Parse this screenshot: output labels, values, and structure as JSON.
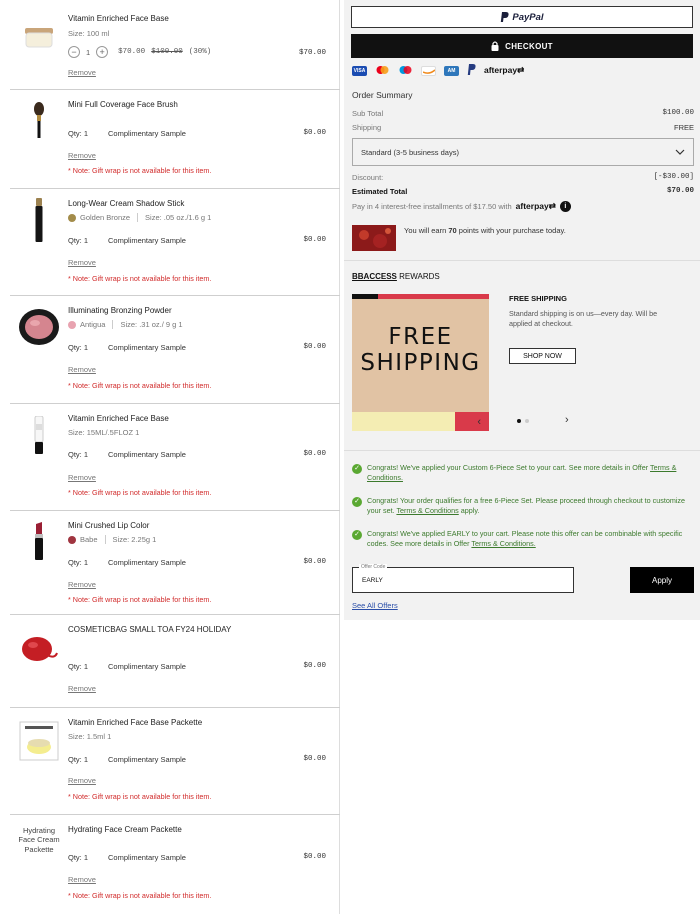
{
  "cart": {
    "items": [
      {
        "name": "Vitamin Enriched Face Base",
        "size": "Size: 100 ml",
        "qty_value": "1",
        "price_sale": "$70.00",
        "price_orig": "$100.00",
        "discount": "(30%)",
        "total": "$70.00",
        "remove": "Remove"
      },
      {
        "name": "Mini Full Coverage Face Brush",
        "qty": "Qty: 1",
        "comp": "Complimentary Sample",
        "total": "$0.00",
        "remove": "Remove",
        "note": "* Note: Gift wrap is not available for this item."
      },
      {
        "name": "Long-Wear Cream Shadow Stick",
        "shade": "Golden Bronze",
        "size": "Size: .05 oz./1.6 g 1",
        "swatch": "#a38c4a",
        "qty": "Qty: 1",
        "comp": "Complimentary Sample",
        "total": "$0.00",
        "remove": "Remove",
        "note": "* Note: Gift wrap is not available for this item."
      },
      {
        "name": "Illuminating Bronzing Powder",
        "shade": "Antigua",
        "size": "Size: .31 oz./ 9 g 1",
        "swatch": "#e8a3b0",
        "qty": "Qty: 1",
        "comp": "Complimentary Sample",
        "total": "$0.00",
        "remove": "Remove",
        "note": "* Note: Gift wrap is not available for this item."
      },
      {
        "name": "Vitamin Enriched Face Base",
        "size": "Size: 15ML/.5FLOZ 1",
        "qty": "Qty: 1",
        "comp": "Complimentary Sample",
        "total": "$0.00",
        "remove": "Remove",
        "note": "* Note: Gift wrap is not available for this item."
      },
      {
        "name": "Mini Crushed Lip Color",
        "shade": "Babe",
        "size": "Size: 2.25g 1",
        "swatch": "#a03540",
        "qty": "Qty: 1",
        "comp": "Complimentary Sample",
        "total": "$0.00",
        "remove": "Remove",
        "note": "* Note: Gift wrap is not available for this item."
      },
      {
        "name": "COSMETICBAG SMALL TOA FY24 HOLIDAY",
        "qty": "Qty: 1",
        "comp": "Complimentary Sample",
        "total": "$0.00",
        "remove": "Remove"
      },
      {
        "name": "Vitamin Enriched Face Base Packette",
        "size": "Size: 1.5ml 1",
        "qty": "Qty: 1",
        "comp": "Complimentary Sample",
        "total": "$0.00",
        "remove": "Remove",
        "note": "* Note: Gift wrap is not available for this item."
      },
      {
        "name": "Hydrating Face Cream Packette",
        "alt": "Hydrating Face Cream Packette",
        "qty": "Qty: 1",
        "comp": "Complimentary Sample",
        "total": "$0.00",
        "remove": "Remove",
        "note": "* Note: Gift wrap is not available for this item."
      }
    ]
  },
  "summary": {
    "paypal": "PayPal",
    "checkout": "CHECKOUT",
    "afterpay_label": "afterpay",
    "title": "Order Summary",
    "subtotal_label": "Sub Total",
    "subtotal_value": "$100.00",
    "shipping_label": "Shipping",
    "shipping_value": "FREE",
    "shipping_method": "Standard (3-5 business days)",
    "discount_label": "Discount:",
    "discount_value": "[-$30.00]",
    "estimated_label": "Estimated Total",
    "estimated_value": "$70.00",
    "installments": "Pay in 4 interest-free installments of $17.50 with",
    "points": "You will earn",
    "points_value": "70",
    "points_tail": "points with your purchase today."
  },
  "rewards": {
    "title_bold": "BBACCESS",
    "title_rest": " REWARDS",
    "banner_line1": "FREE",
    "banner_line2": "SHIPPING",
    "heading": "FREE SHIPPING",
    "text": "Standard shipping is on us—every day. Will be applied at checkout.",
    "cta": "SHOP NOW"
  },
  "offers": {
    "messages": [
      {
        "text": "Congrats! We've applied your Custom 6-Piece Set to your cart. See more details in Offer ",
        "link": "Terms & Conditions.",
        "tail": ""
      },
      {
        "text": "Congrats! Your order qualifies for a free 6-Piece Set. Please proceed through checkout to customize your set. ",
        "link": "Terms & Conditions",
        "tail": " apply."
      },
      {
        "text": "Congrats! We've applied EARLY to your cart. Please note this offer can be combinable with specific codes. See more details in Offer ",
        "link": "Terms & Conditions.",
        "tail": ""
      }
    ],
    "code_label": "Offer Code",
    "code_value": "EARLY",
    "apply": "Apply",
    "see_all": "See All Offers"
  }
}
